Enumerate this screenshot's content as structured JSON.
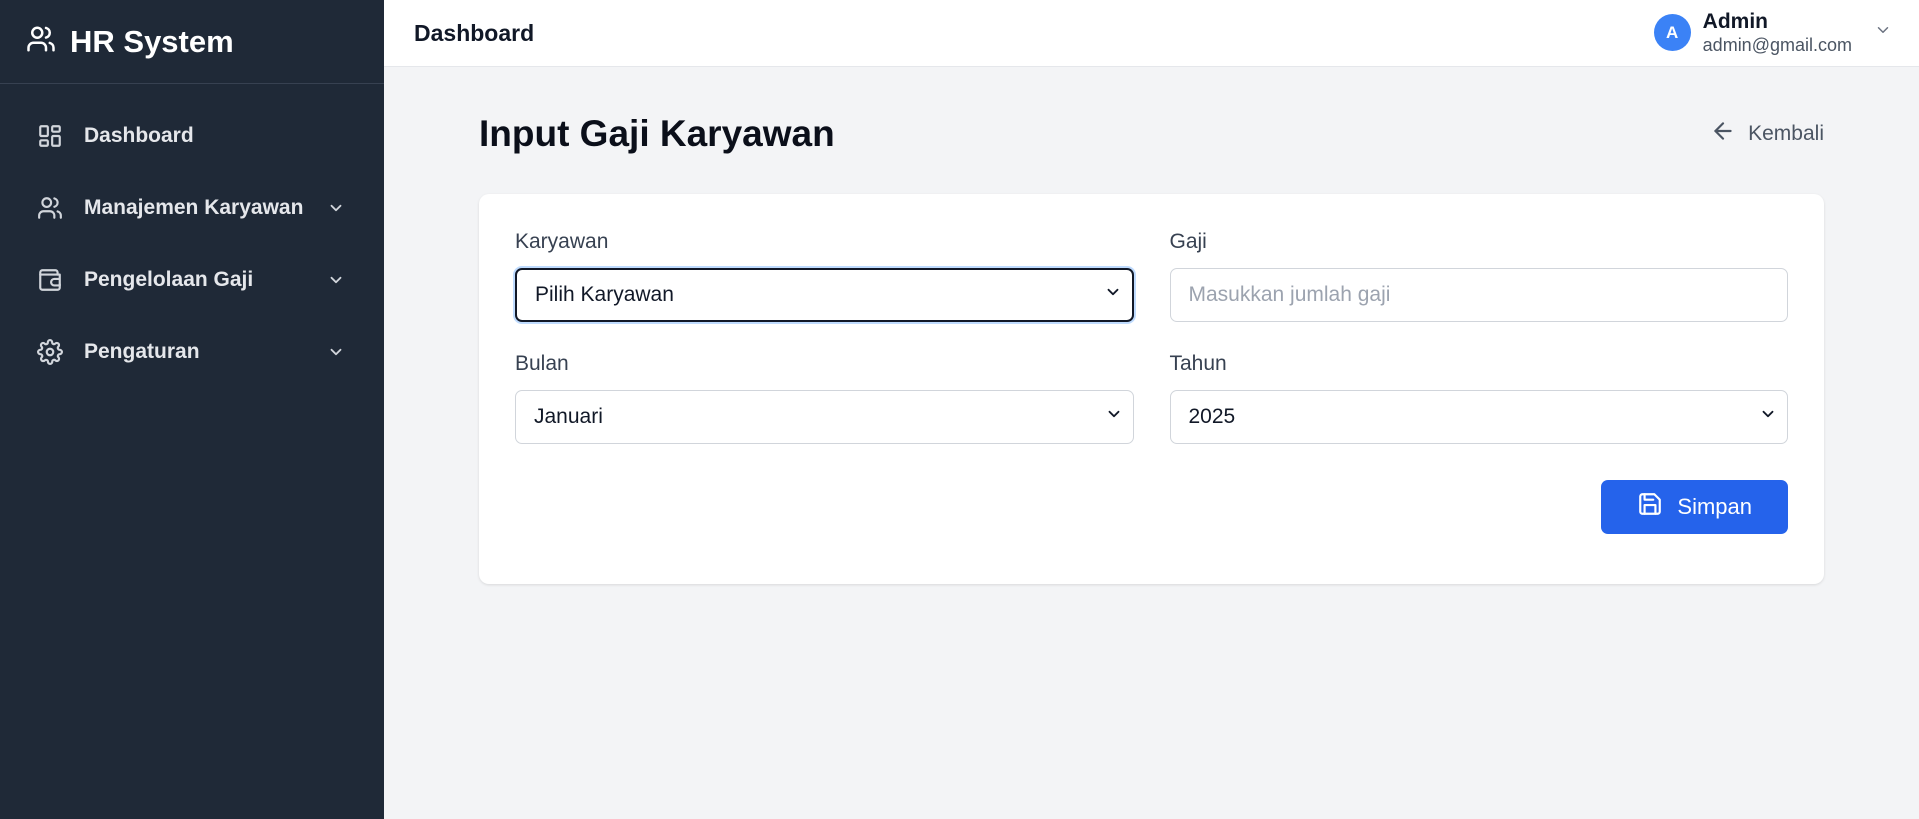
{
  "sidebar": {
    "brand": "HR System",
    "items": [
      {
        "label": "Dashboard",
        "icon": "dashboard-grid-icon",
        "has_submenu": false
      },
      {
        "label": "Manajemen Karyawan",
        "icon": "users-icon",
        "has_submenu": true
      },
      {
        "label": "Pengelolaan Gaji",
        "icon": "wallet-icon",
        "has_submenu": true
      },
      {
        "label": "Pengaturan",
        "icon": "gear-icon",
        "has_submenu": true
      }
    ]
  },
  "topbar": {
    "title": "Dashboard",
    "user": {
      "initial": "A",
      "name": "Admin",
      "email": "admin@gmail.com"
    }
  },
  "page": {
    "title": "Input Gaji Karyawan",
    "back_label": "Kembali"
  },
  "form": {
    "karyawan": {
      "label": "Karyawan",
      "value": "Pilih Karyawan"
    },
    "gaji": {
      "label": "Gaji",
      "value": "",
      "placeholder": "Masukkan jumlah gaji"
    },
    "bulan": {
      "label": "Bulan",
      "value": "Januari"
    },
    "tahun": {
      "label": "Tahun",
      "value": "2025"
    },
    "save_label": "Simpan"
  },
  "colors": {
    "sidebar_bg": "#1f2937",
    "primary": "#2563eb",
    "avatar": "#3b82f6",
    "page_bg": "#f3f4f6"
  }
}
